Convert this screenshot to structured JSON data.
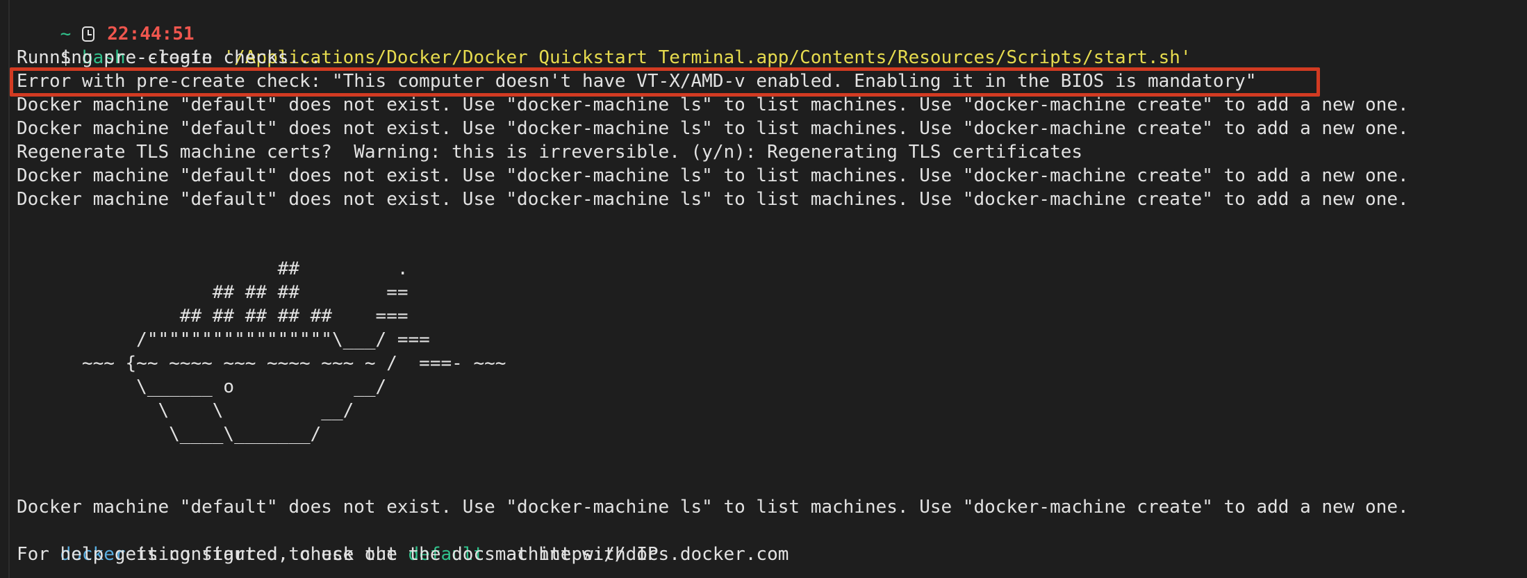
{
  "prompt_line": {
    "tilde": "~",
    "clock_icon": "clock-icon",
    "time": "22:44:51"
  },
  "command_line": {
    "prompt": "$ ",
    "command": "bash",
    "args": " --login ",
    "path": "'/Applications/Docker/Docker Quickstart Terminal.app/Contents/Resources/Scripts/start.sh'"
  },
  "output": {
    "running_checks": "Running pre-create checks...",
    "error_line": "Error with pre-create check: \"This computer doesn't have VT-X/AMD-v enabled. Enabling it in the BIOS is mandatory\"",
    "not_exist_1": "Docker machine \"default\" does not exist. Use \"docker-machine ls\" to list machines. Use \"docker-machine create\" to add a new one.",
    "not_exist_2": "Docker machine \"default\" does not exist. Use \"docker-machine ls\" to list machines. Use \"docker-machine create\" to add a new one.",
    "regenerate": "Regenerate TLS machine certs?  Warning: this is irreversible. (y/n): Regenerating TLS certificates",
    "not_exist_3": "Docker machine \"default\" does not exist. Use \"docker-machine ls\" to list machines. Use \"docker-machine create\" to add a new one.",
    "not_exist_4": "Docker machine \"default\" does not exist. Use \"docker-machine ls\" to list machines. Use \"docker-machine create\" to add a new one.",
    "ascii_whale": "                        ##         .\n                  ## ## ##        ==\n               ## ## ## ## ##    ===\n           /\"\"\"\"\"\"\"\"\"\"\"\"\"\"\"\"\"\\___/ ===\n      ~~~ {~~ ~~~~ ~~~ ~~~~ ~~~ ~ /  ===- ~~~\n           \\______ o           __/\n             \\    \\         __/\n              \\____\\_______/",
    "not_exist_5": "Docker machine \"default\" does not exist. Use \"docker-machine ls\" to list machines. Use \"docker-machine create\" to add a new one.",
    "configured": {
      "docker": "docker",
      "mid": " is configured to use the ",
      "machine": "default",
      "tail": " machine with IP"
    },
    "help": "For help getting started, check out the docs at https://docs.docker.com"
  },
  "colors": {
    "background": "#1e1e1e",
    "text": "#e2e2e2",
    "time": "#f0564e",
    "green": "#31c28c",
    "yellow": "#e6db4e",
    "blue": "#5aaee0",
    "highlight_border": "#d23b22"
  }
}
